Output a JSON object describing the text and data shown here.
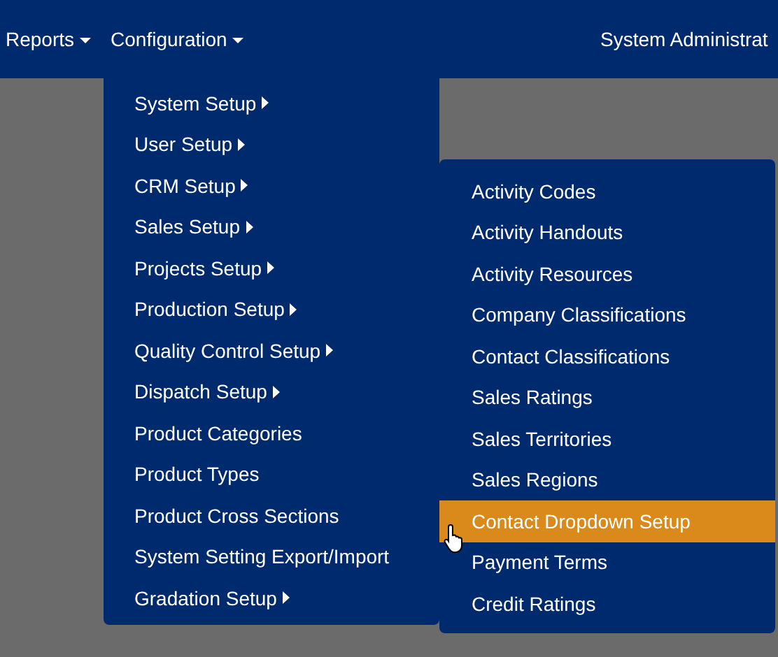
{
  "nav": {
    "items": [
      {
        "label": "Reports",
        "has_dropdown": true
      },
      {
        "label": "Configuration",
        "has_dropdown": true
      }
    ],
    "user": "System Administrat"
  },
  "menu": {
    "items": [
      {
        "label": "System Setup",
        "has_submenu": true
      },
      {
        "label": "User Setup",
        "has_submenu": true
      },
      {
        "label": "CRM Setup",
        "has_submenu": true
      },
      {
        "label": "Sales Setup",
        "has_submenu": true
      },
      {
        "label": "Projects Setup",
        "has_submenu": true
      },
      {
        "label": "Production Setup",
        "has_submenu": true
      },
      {
        "label": "Quality Control Setup",
        "has_submenu": true
      },
      {
        "label": "Dispatch Setup",
        "has_submenu": true
      },
      {
        "label": "Product Categories",
        "has_submenu": false
      },
      {
        "label": "Product Types",
        "has_submenu": false
      },
      {
        "label": "Product Cross Sections",
        "has_submenu": false
      },
      {
        "label": "System Setting Export/Import",
        "has_submenu": false
      },
      {
        "label": "Gradation Setup",
        "has_submenu": true
      }
    ]
  },
  "submenu": {
    "items": [
      {
        "label": "Activity Codes",
        "selected": false
      },
      {
        "label": "Activity Handouts",
        "selected": false
      },
      {
        "label": "Activity Resources",
        "selected": false
      },
      {
        "label": "Company Classifications",
        "selected": false
      },
      {
        "label": "Contact Classifications",
        "selected": false
      },
      {
        "label": "Sales Ratings",
        "selected": false
      },
      {
        "label": "Sales Territories",
        "selected": false
      },
      {
        "label": "Sales Regions",
        "selected": false
      },
      {
        "label": "Contact Dropdown Setup",
        "selected": true
      },
      {
        "label": "Payment Terms",
        "selected": false
      },
      {
        "label": "Credit Ratings",
        "selected": false
      }
    ]
  }
}
